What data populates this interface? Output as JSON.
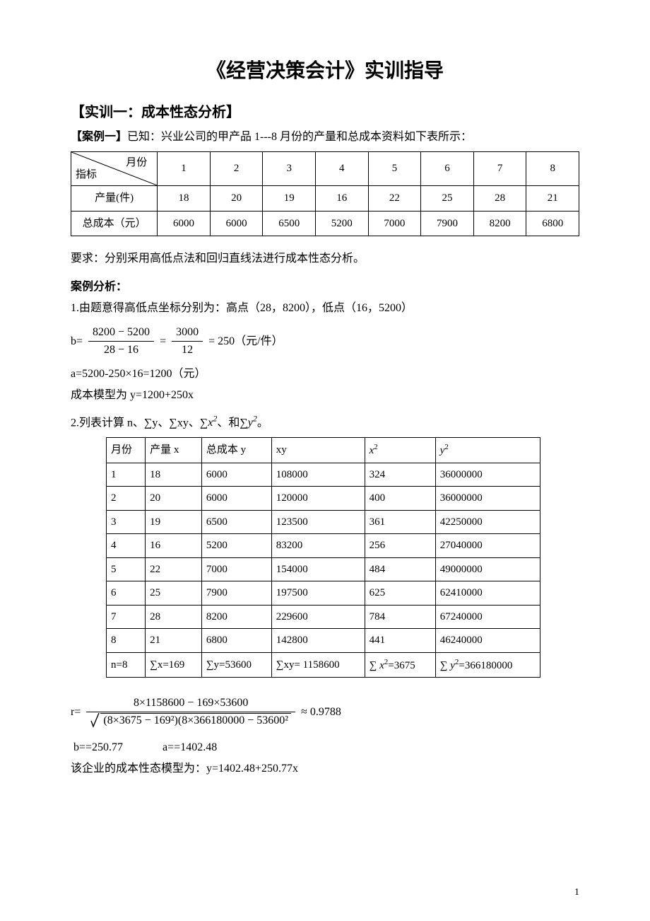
{
  "title": "《经营决策会计》实训指导",
  "section_heading": "【实训一：成本性态分析】",
  "case_label": "【案例一】",
  "case_text": "已知：兴业公司的甲产品 1---8 月份的产量和总成本资料如下表所示：",
  "table1": {
    "diag_top": "月份",
    "diag_bottom": "指标",
    "row1_label": "产量(件)",
    "row2_label": "总成本（元）",
    "months": [
      "1",
      "2",
      "3",
      "4",
      "5",
      "6",
      "7",
      "8"
    ],
    "output": [
      "18",
      "20",
      "19",
      "16",
      "22",
      "25",
      "28",
      "21"
    ],
    "cost": [
      "6000",
      "6000",
      "6500",
      "5200",
      "7000",
      "7900",
      "8200",
      "6800"
    ]
  },
  "requirement": "要求：分别采用高低点法和回归直线法进行成本性态分析。",
  "analysis_heading": "案例分析：",
  "step1_line1": "1.由题意得高低点坐标分别为：高点（28，8200），低点（16，5200）",
  "step1_formula": {
    "prefix": "b=",
    "num1": "8200 − 5200",
    "den1": "28 − 16",
    "num2": "3000",
    "den2": "12",
    "suffix": "250（元/件）"
  },
  "step1_a": "a=5200-250×16=1200（元）",
  "step1_model": "成本模型为   y=1200+250x",
  "step2_intro_prefix": "2.列表计算 n、∑y、∑xy、∑",
  "step2_intro_mid": "、和∑",
  "step2_intro_suffix": "。",
  "step2_x2": "x",
  "step2_y2": "y",
  "table2": {
    "head": {
      "m": "月份",
      "x": "产量 x",
      "y": "总成本 y",
      "xy": "xy"
    },
    "rows": [
      {
        "m": "1",
        "x": "18",
        "y": "6000",
        "xy": "108000",
        "x2": "324",
        "y2": "36000000"
      },
      {
        "m": "2",
        "x": "20",
        "y": "6000",
        "xy": "120000",
        "x2": "400",
        "y2": "36000000"
      },
      {
        "m": "3",
        "x": "19",
        "y": "6500",
        "xy": "123500",
        "x2": "361",
        "y2": "42250000"
      },
      {
        "m": "4",
        "x": "16",
        "y": "5200",
        "xy": "83200",
        "x2": "256",
        "y2": "27040000"
      },
      {
        "m": "5",
        "x": "22",
        "y": "7000",
        "xy": "154000",
        "x2": "484",
        "y2": "49000000"
      },
      {
        "m": "6",
        "x": "25",
        "y": "7900",
        "xy": "197500",
        "x2": "625",
        "y2": "62410000"
      },
      {
        "m": "7",
        "x": "28",
        "y": "8200",
        "xy": "229600",
        "x2": "784",
        "y2": "67240000"
      },
      {
        "m": "8",
        "x": "21",
        "y": "6800",
        "xy": "142800",
        "x2": "441",
        "y2": "46240000"
      }
    ],
    "sums": {
      "n": " n=8",
      "sx": "∑x=169",
      "sy": "∑y=53600",
      "sxy": "∑xy= 1158600",
      "sx2_prefix": "∑",
      "sx2_val": "=3675",
      "sy2_prefix": "∑",
      "sy2_val": "=366180000"
    }
  },
  "r_formula": {
    "prefix": "r=",
    "num": "8×1158600 − 169×53600",
    "den_inner": "(8×3675 − 169²)(8×366180000 − 53600²",
    "approx": "≈ 0.9788"
  },
  "b_result": " b==250.77              a==1402.48",
  "final_model": "该企业的成本性态模型为：y=1402.48+250.77x",
  "page_number": "1"
}
